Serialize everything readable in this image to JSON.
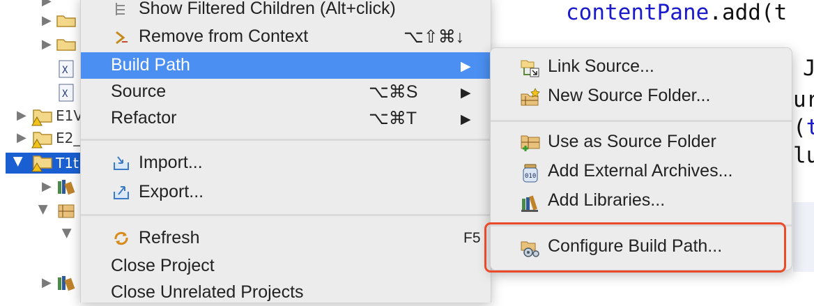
{
  "explorer": {
    "projects": [
      {
        "label": "E1V",
        "warning": true
      },
      {
        "label": "E2_",
        "warning": true
      },
      {
        "label": "T1t",
        "warning": true,
        "selected": true
      }
    ]
  },
  "editor": {
    "lines": [
      {
        "kw": "contentPane",
        "rest": ".add(t"
      },
      {
        "kw": "",
        "rest": "J"
      },
      {
        "kw": "",
        "rest": "ur"
      },
      {
        "kw": "t",
        "pre": "(",
        "rest": ""
      },
      {
        "kw": "",
        "rest": "lu"
      }
    ]
  },
  "context_menu": {
    "items": [
      {
        "label": "Show Filtered Children (Alt+click)",
        "icon": "filter-icon"
      },
      {
        "label": "Remove from Context",
        "shortcut": "⌥⇧⌘↓",
        "icon": "remove-context-icon"
      },
      {
        "label": "Build Path",
        "submenu": true,
        "highlighted": true
      },
      {
        "label": "Source",
        "shortcut": "⌥⌘S",
        "submenu": true
      },
      {
        "label": "Refactor",
        "shortcut": "⌥⌘T",
        "submenu": true
      },
      {
        "label": "Import...",
        "icon": "import-icon"
      },
      {
        "label": "Export...",
        "icon": "export-icon"
      },
      {
        "label": "Refresh",
        "shortcut": "F5",
        "icon": "refresh-icon"
      },
      {
        "label": "Close Project"
      },
      {
        "label": "Close Unrelated Projects"
      }
    ],
    "submenu_arrow": "▶"
  },
  "submenu": {
    "items": [
      {
        "label": "Link Source...",
        "icon": "link-source-icon"
      },
      {
        "label": "New Source Folder...",
        "icon": "new-source-folder-icon"
      },
      {
        "label": "Use as Source Folder",
        "icon": "use-source-folder-icon"
      },
      {
        "label": "Add External Archives...",
        "icon": "jar-archive-icon"
      },
      {
        "label": "Add Libraries...",
        "icon": "libraries-icon"
      },
      {
        "label": "Configure Build Path...",
        "icon": "configure-build-path-icon",
        "emphasized": true
      }
    ]
  },
  "colors": {
    "highlight": "#4a8ff1",
    "selection": "#1a5fd1",
    "emphasis_box": "#ea4a2a",
    "keyword": "#1a1acc"
  }
}
